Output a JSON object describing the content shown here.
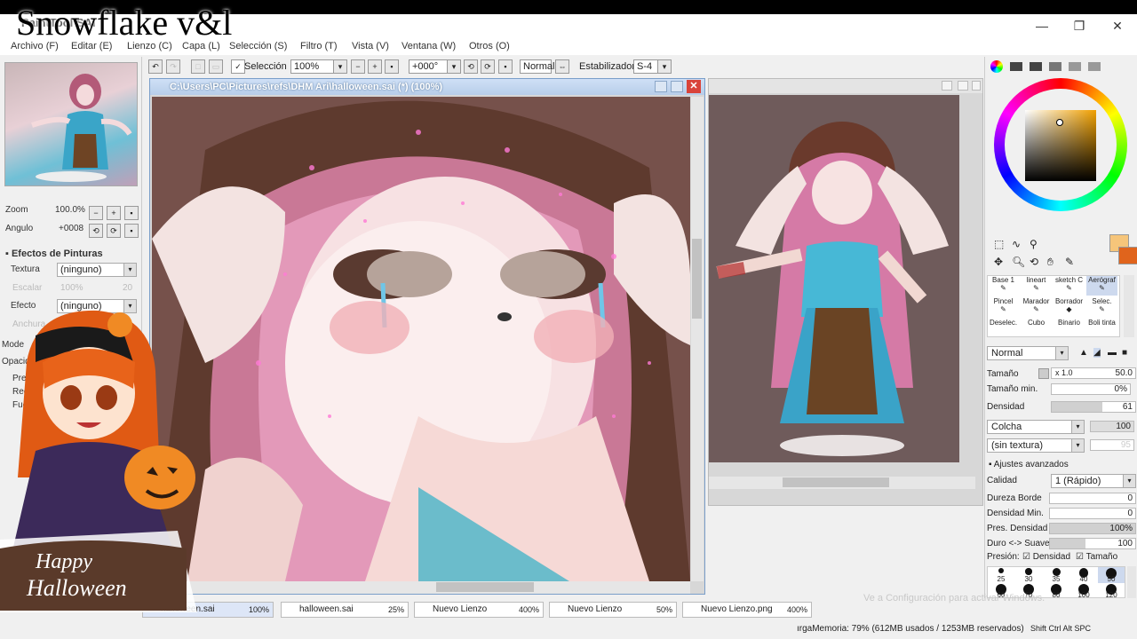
{
  "overlay": {
    "watermark": "Snowflake v&l"
  },
  "window": {
    "app_title": "PaintTool SAI",
    "minimize": "—",
    "maximize": "❐",
    "close": "✕"
  },
  "menu": [
    "Archivo (F)",
    "Editar (E)",
    "Lienzo (C)",
    "Capa (L)",
    "Selección (S)",
    "Filtro (T)",
    "Vista (V)",
    "Ventana (W)",
    "Otros (O)"
  ],
  "toolbar": {
    "selection_label": "Selección",
    "zoom_value": "100%",
    "angle_value": "+000°",
    "blend_mode": "Normal",
    "stabilizer_label": "Estabilizador",
    "stabilizer_value": "S-4"
  },
  "left_panel": {
    "zoom_label": "Zoom",
    "zoom_value": "100.0%",
    "angle_label": "Angulo",
    "angle_value": "+0008",
    "effects_title": "Efectos de Pinturas",
    "texture_label": "Textura",
    "texture_value": "(ninguno)",
    "escalar_label": "Escalar",
    "escalar_value": "100%",
    "escalar_num": "20",
    "effect_label": "Efecto",
    "effect_value": "(ninguno)",
    "anchura_label": "Anchura",
    "mode_label": "Mode",
    "opacity_label": "Opacidad",
    "check1": "Pre",
    "check2": "Rec",
    "check3": "Fue"
  },
  "sticker": {
    "happy": "Happy",
    "halloween": "Halloween"
  },
  "canvas": {
    "title": "C:\\Users\\PC\\Pictures\\refs\\DHM Ari\\halloween.sai (*) (100%)"
  },
  "right_panel": {
    "brushes": [
      {
        "name": "Base 1"
      },
      {
        "name": "lineart"
      },
      {
        "name": "sketch C"
      },
      {
        "name": "Aerógraf"
      },
      {
        "name": "Pincel"
      },
      {
        "name": "Marador"
      },
      {
        "name": "Borrador"
      },
      {
        "name": "Selec."
      },
      {
        "name": "Deselec."
      },
      {
        "name": "Cubo"
      },
      {
        "name": "Binario"
      },
      {
        "name": "Boli tinta"
      }
    ],
    "blend_mode": "Normal",
    "size_label": "Tamaño",
    "size_mult": "x 1.0",
    "size_value": "50.0",
    "min_size_label": "Tamaño min.",
    "min_size_value": "0%",
    "density_label": "Densidad",
    "density_value": "61",
    "density_fill": 0.61,
    "shape_value": "Colcha",
    "shape_num": "100",
    "texture_value": "(sin textura)",
    "texture_num": "95",
    "advanced_title": "Ajustes avanzados",
    "quality_label": "Calidad",
    "quality_value": "1 (Rápido)",
    "edge_label": "Dureza Borde",
    "edge_value": "0",
    "min_density_label": "Densidad Min.",
    "min_density_value": "0",
    "pressure_density_label": "Pres. Densidad M",
    "pressure_density_value": "100%",
    "hard_soft_label": "Duro <-> Suave",
    "hard_soft_value": "100",
    "pressure_label": "Presión:",
    "pressure_density_check": "Densidad",
    "pressure_size_check": "Tamaño",
    "dot_sizes": [
      "25",
      "30",
      "35",
      "40",
      "50",
      "60",
      "70",
      "80",
      "100",
      "120"
    ]
  },
  "tabs": [
    {
      "name": "halloween.sai",
      "pct": "100%"
    },
    {
      "name": "halloween.sai",
      "pct": "25%"
    },
    {
      "name": "Nuevo Lienzo",
      "pct": "400%"
    },
    {
      "name": "Nuevo Lienzo",
      "pct": "50%"
    },
    {
      "name": "Nuevo Lienzo.png",
      "pct": "400%"
    }
  ],
  "status": {
    "memory": "ırgaMemoria: 79% (612MB usados / 1253MB reservados)",
    "keys": "Shift Ctrl Alt SPC",
    "activate": "Ve a Configuración para activar Windows."
  },
  "colors": {
    "primary": "#f6c57a",
    "secondary": "#e0641c"
  }
}
